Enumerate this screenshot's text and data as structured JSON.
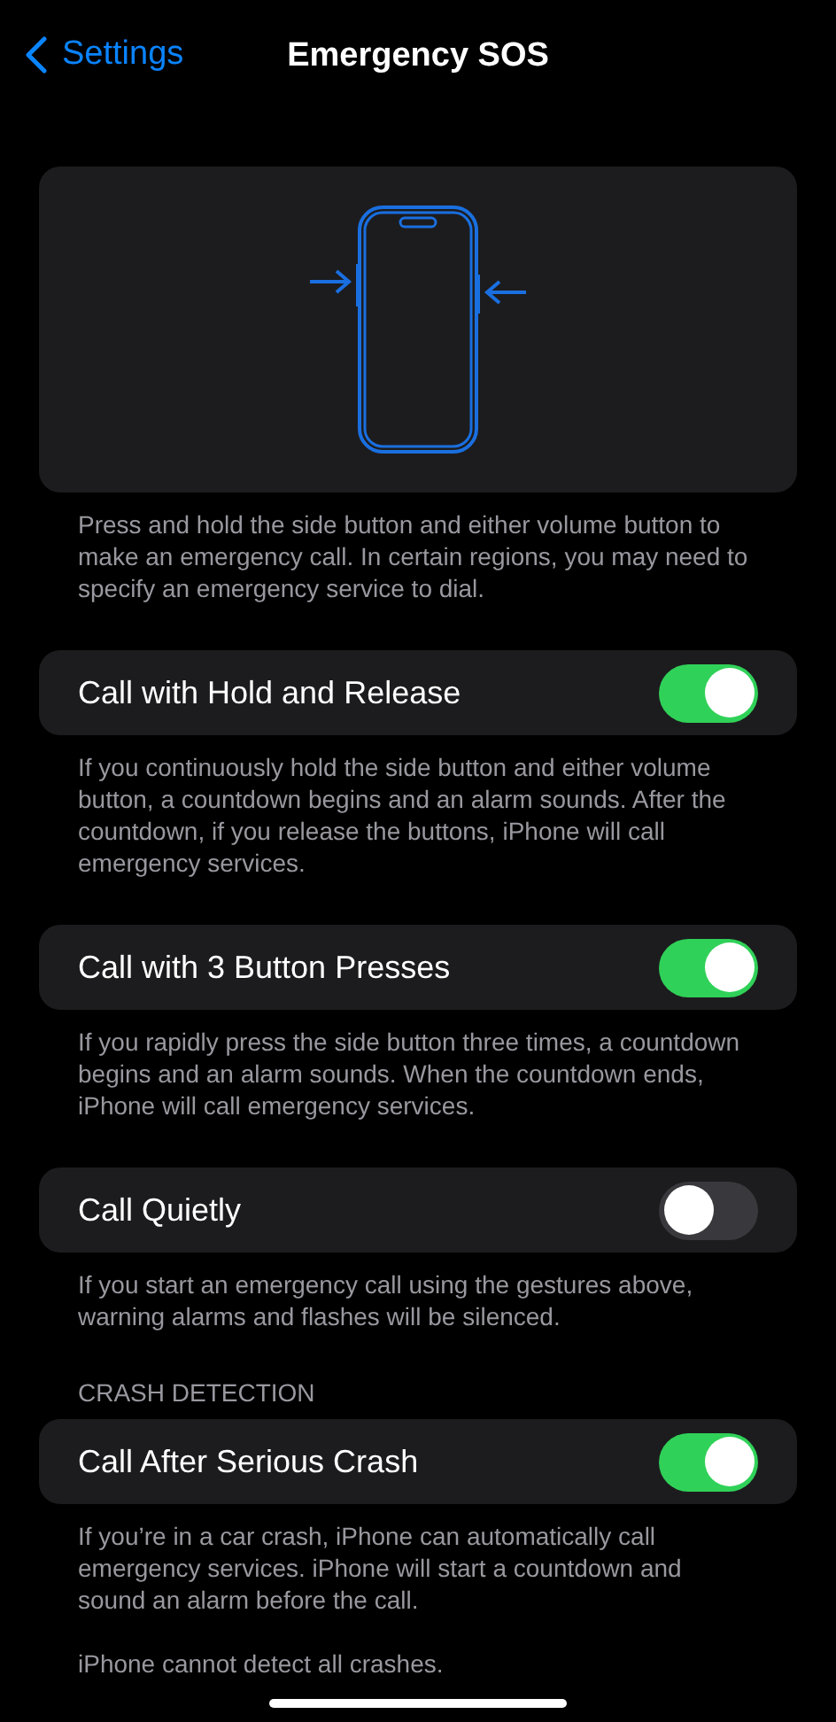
{
  "nav": {
    "back_label": "Settings",
    "title": "Emergency SOS"
  },
  "illustration": {
    "caption": "Press and hold the side button and either volume button to make an emergency call. In certain regions, you may need to specify an emergency service to dial."
  },
  "groups": [
    {
      "rows": [
        {
          "label": "Call with Hold and Release",
          "on": true
        }
      ],
      "footer": [
        "If you continuously hold the side button and either volume button, a countdown begins and an alarm sounds. After the countdown, if you release the buttons, iPhone will call emergency services."
      ]
    },
    {
      "rows": [
        {
          "label": "Call with 3 Button Presses",
          "on": true
        }
      ],
      "footer": [
        "If you rapidly press the side button three times, a countdown begins and an alarm sounds. When the countdown ends, iPhone will call emergency services."
      ]
    },
    {
      "rows": [
        {
          "label": "Call Quietly",
          "on": false
        }
      ],
      "footer": [
        "If you start an emergency call using the gestures above, warning alarms and flashes will be silenced."
      ]
    },
    {
      "header": "CRASH DETECTION",
      "rows": [
        {
          "label": "Call After Serious Crash",
          "on": true
        }
      ],
      "footer": [
        "If you’re in a car crash, iPhone can automatically call emergency services. iPhone will start a countdown and sound an alarm before the call.",
        "iPhone cannot detect all crashes."
      ]
    }
  ]
}
